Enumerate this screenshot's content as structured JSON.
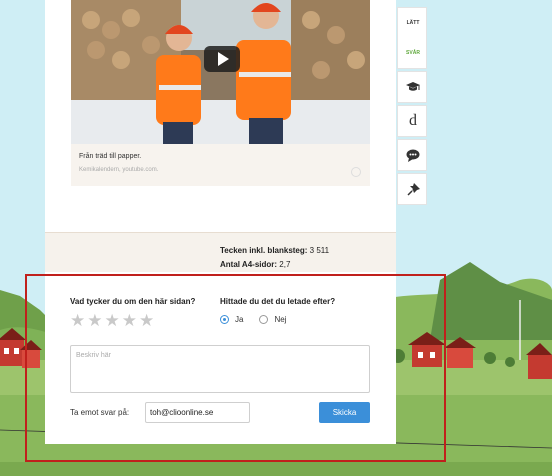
{
  "video": {
    "caption_title": "Från träd till papper.",
    "caption_source": "Kemikalendern, youtube.com."
  },
  "stats": {
    "chars_label": "Tecken inkl. blanksteg:",
    "chars_value": "3 511",
    "pages_label": "Antal A4-sidor:",
    "pages_value": "2,7"
  },
  "feedback": {
    "rating_question": "Vad tycker du om den här sidan?",
    "found_question": "Hittade du det du letade efter?",
    "stars": [
      "★",
      "★",
      "★",
      "★",
      "★"
    ],
    "options": [
      {
        "label": "Ja",
        "selected": true
      },
      {
        "label": "Nej",
        "selected": false
      }
    ],
    "textarea_placeholder": "Beskriv här",
    "reply_label": "Ta emot svar på:",
    "email_value": "toh@clioonline.se",
    "send_label": "Skicka"
  },
  "toolbar": {
    "easy_label": "LÄTT",
    "hard_label": "SVÅR",
    "icons": [
      "graduation-cap-icon",
      "d-glyph-icon",
      "speech-bubble-icon",
      "pin-icon"
    ],
    "d_glyph": "d"
  },
  "colors": {
    "accent": "#3b8fd9",
    "highlight": "#c0201c",
    "hard_green": "#5fa83b"
  }
}
